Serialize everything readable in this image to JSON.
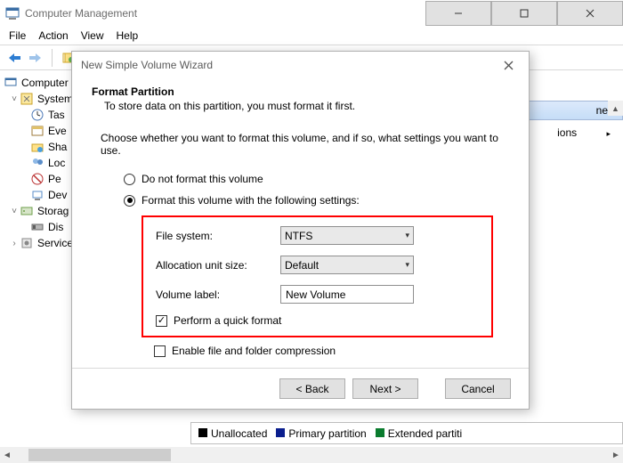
{
  "app_title": "Computer Management",
  "menu": {
    "file": "File",
    "action": "Action",
    "view": "View",
    "help": "Help"
  },
  "tree": {
    "root": "Computer",
    "system": "System",
    "tas": "Tas",
    "eve": "Eve",
    "sha": "Sha",
    "loc": "Loc",
    "per": "Pe",
    "dev": "Dev",
    "storage": "Storag",
    "disk": "Dis",
    "services": "Service"
  },
  "right_col": {
    "header_suffix": "nent",
    "actions_suffix": "ions",
    "chevron": "▸"
  },
  "wizard": {
    "title": "New Simple Volume Wizard",
    "heading": "Format Partition",
    "subheading": "To store data on this partition, you must format it first.",
    "instruction": "Choose whether you want to format this volume, and if so, what settings you want to use.",
    "radio_no_format": "Do not format this volume",
    "radio_format": "Format this volume with the following settings:",
    "fs_label": "File system:",
    "fs_value": "NTFS",
    "aus_label": "Allocation unit size:",
    "aus_value": "Default",
    "vol_label_label": "Volume label:",
    "vol_label_value": "New Volume",
    "quick_format": "Perform a quick format",
    "compression": "Enable file and folder compression",
    "back": "< Back",
    "next": "Next >",
    "cancel": "Cancel"
  },
  "legend": {
    "unallocated": "Unallocated",
    "primary": "Primary partition",
    "extended": "Extended partiti"
  }
}
